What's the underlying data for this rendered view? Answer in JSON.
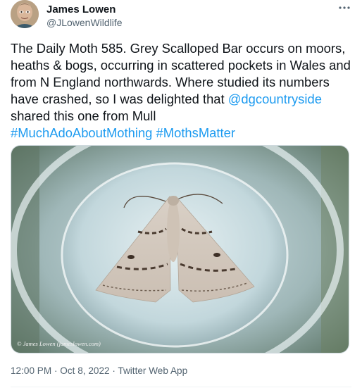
{
  "author": {
    "name": "James Lowen",
    "handle": "@JLowenWildlife",
    "avatar_icon": "person-photo-icon"
  },
  "more_icon": "ellipsis-icon",
  "tweet": {
    "text_part1": "The Daily Moth 585. Grey Scalloped Bar occurs on moors, heaths & bogs, occurring in scattered pockets in Wales and from N England northwards. Where studied its numbers have crashed, so I was delighted that ",
    "mention": "@dgcountryside",
    "text_part2": " shared this one from Mull",
    "hashtag1": "#MuchAdoAboutMothing",
    "hashtag2": "#MothsMatter"
  },
  "media": {
    "credit": "© James Lowen (jameslowen.com)"
  },
  "meta": {
    "time": "12:00 PM",
    "separator1": " · ",
    "date": "Oct 8, 2022",
    "separator2": " · ",
    "source": "Twitter Web App"
  },
  "colors": {
    "link": "#1d9bf0",
    "text": "#0f1419",
    "muted": "#536471"
  }
}
